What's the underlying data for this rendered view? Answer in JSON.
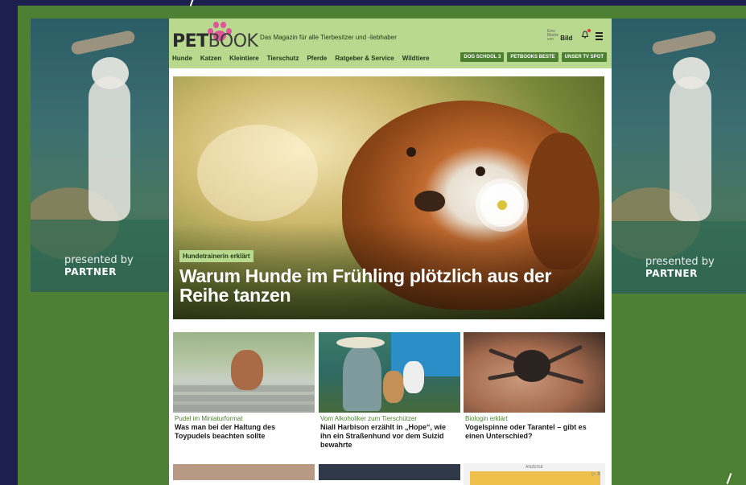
{
  "side_ads": {
    "left": {
      "presented_by": "presented by",
      "brand": "PARTNER"
    },
    "right": {
      "presented_by": "presented by",
      "brand": "PARTNER"
    }
  },
  "header": {
    "logo_pet": "PET",
    "logo_book": "BOOK",
    "tagline": "Das Magazin für alle Tierbesitzer und -liebhaber",
    "bild_small": "Eine Marke von",
    "bild": "Bild",
    "nav": [
      "Hunde",
      "Katzen",
      "Kleintiere",
      "Tierschutz",
      "Pferde",
      "Ratgeber & Service",
      "Wildtiere"
    ],
    "pills": [
      "DOG SCHOOL 3",
      "PETBOOKS BESTE",
      "UNSER TV SPOT"
    ],
    "accent": "#4e8033",
    "header_bg": "#b9d98e"
  },
  "hero": {
    "kicker": "Hundetrainerin erklärt",
    "title": "Warum Hunde im Frühling plötzlich aus der Reihe tanzen"
  },
  "cards": [
    {
      "kicker": "Pudel im Miniaturformat",
      "title": "Was man bei der Haltung des Toypudels beachten sollte"
    },
    {
      "kicker": "Vom Alkoholiker zum Tierschützer",
      "title": "Niall Harbison erzählt in „Hope“, wie ihn ein Straßenhund vor dem Suizid bewahrte"
    },
    {
      "kicker": "Biologin erklärt",
      "title": "Vogelspinne oder Tarantel – gibt es einen Unterschied?"
    }
  ],
  "ad": {
    "label": "ANZEIGE",
    "close": "▷ X"
  }
}
